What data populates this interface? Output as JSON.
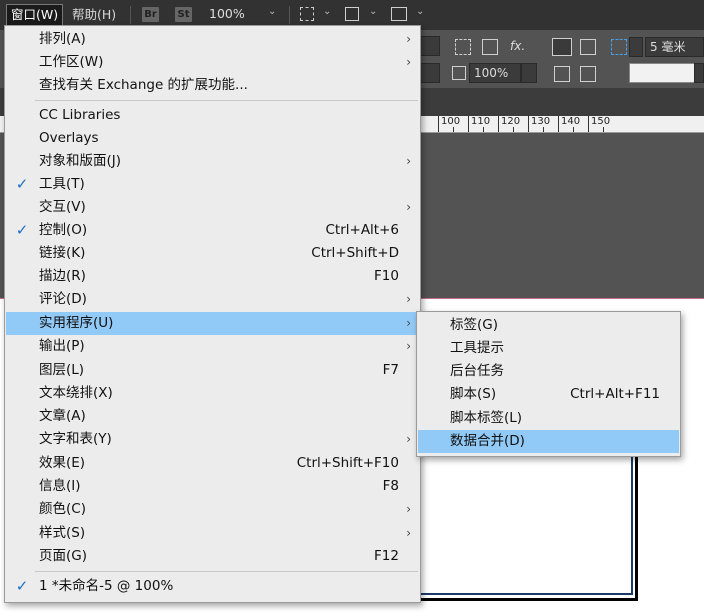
{
  "menubar": {
    "window_label": "窗口(W)",
    "help_label": "帮助(H)",
    "br_badge": "Br",
    "st_badge": "St",
    "zoom": "100%"
  },
  "control": {
    "zoom_field": "100%",
    "stroke_weight": "5 毫米",
    "fx_label": "fx."
  },
  "ruler": {
    "labels": [
      "100",
      "110",
      "120",
      "130",
      "140",
      "150"
    ]
  },
  "window_menu": {
    "items": [
      {
        "label": "排列(A)",
        "submenu": true
      },
      {
        "label": "工作区(W)",
        "submenu": true
      },
      {
        "label": "查找有关 Exchange 的扩展功能..."
      },
      {
        "label": "CC Libraries"
      },
      {
        "label": "Overlays"
      },
      {
        "label": "对象和版面(J)",
        "submenu": true
      },
      {
        "label": "工具(T)",
        "checked": true
      },
      {
        "label": "交互(V)",
        "submenu": true
      },
      {
        "label": "控制(O)",
        "checked": true,
        "shortcut": "Ctrl+Alt+6"
      },
      {
        "label": "链接(K)",
        "shortcut": "Ctrl+Shift+D"
      },
      {
        "label": "描边(R)",
        "shortcut": "F10"
      },
      {
        "label": "评论(D)",
        "submenu": true
      },
      {
        "label": "实用程序(U)",
        "submenu": true,
        "highlighted": true
      },
      {
        "label": "输出(P)",
        "submenu": true
      },
      {
        "label": "图层(L)",
        "shortcut": "F7"
      },
      {
        "label": "文本绕排(X)"
      },
      {
        "label": "文章(A)"
      },
      {
        "label": "文字和表(Y)",
        "submenu": true
      },
      {
        "label": "效果(E)",
        "shortcut": "Ctrl+Shift+F10"
      },
      {
        "label": "信息(I)",
        "shortcut": "F8"
      },
      {
        "label": "颜色(C)",
        "submenu": true
      },
      {
        "label": "样式(S)",
        "submenu": true
      },
      {
        "label": "页面(G)",
        "shortcut": "F12"
      },
      {
        "label": "1 *未命名-5 @ 100%",
        "checked": true
      }
    ]
  },
  "utilities_submenu": {
    "items": [
      {
        "label": "标签(G)"
      },
      {
        "label": "工具提示"
      },
      {
        "label": "后台任务"
      },
      {
        "label": "脚本(S)",
        "shortcut": "Ctrl+Alt+F11"
      },
      {
        "label": "脚本标签(L)"
      },
      {
        "label": "数据合并(D)",
        "highlighted": true
      }
    ]
  },
  "glyphs": {
    "check": "✓",
    "arrow": "›",
    "caret": "⌄"
  },
  "colors": {
    "highlight": "#91c9f7",
    "menu_bg": "#ececec",
    "check": "#1d6fc9"
  }
}
